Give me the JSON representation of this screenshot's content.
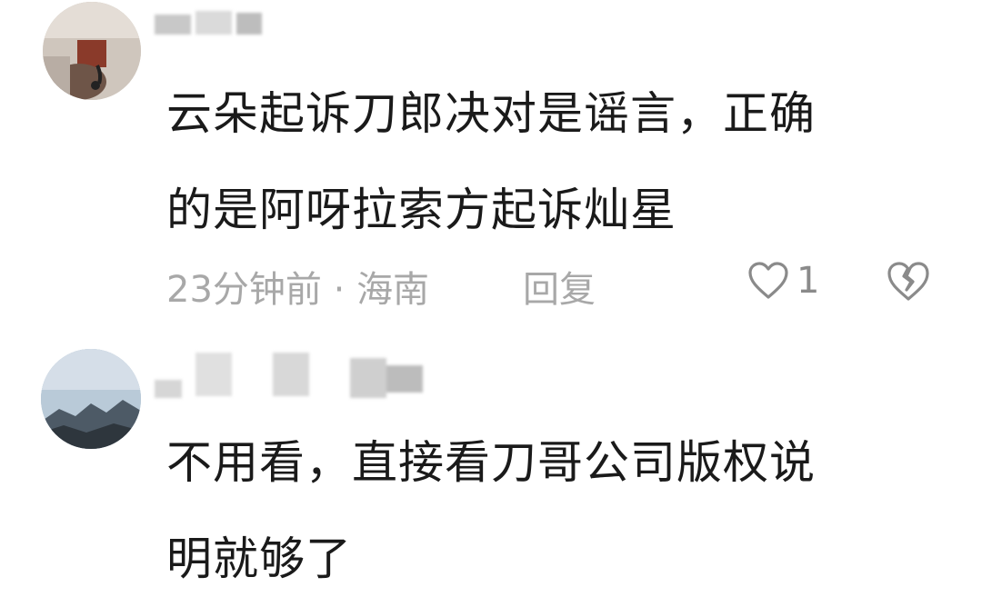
{
  "comments": [
    {
      "text_line1": "云朵起诉刀郎决对是谣言，正确",
      "text_line2": "的是阿呀拉索方起诉灿星",
      "time": "23分钟前",
      "separator": "·",
      "location": "海南",
      "reply_label": "回复",
      "like_count": "1",
      "icons": [
        "heart-icon",
        "broken-heart-icon"
      ]
    },
    {
      "text_line1": "不用看，直接看刀哥公司版权说",
      "text_line2": "明就够了"
    }
  ]
}
